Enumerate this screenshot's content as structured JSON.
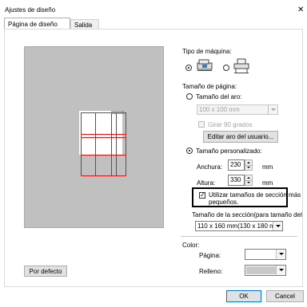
{
  "window": {
    "title": "Ajustes de diseño"
  },
  "tabs": [
    {
      "label": "Página de diseño",
      "active": true
    },
    {
      "label": "Salida",
      "active": false
    }
  ],
  "machine": {
    "label": "Tipo de máquina:"
  },
  "page_size": {
    "label": "Tamaño de página:",
    "hoop_option": "Tamaño del aro:",
    "hoop_value": "100 x 100 mm",
    "rotate_label": "Girar 90 grados",
    "edit_hoop_button": "Editar aro del usuario...",
    "custom_option": "Tamaño personalizado:",
    "width_label": "Anchura:",
    "width_value": "230",
    "height_label": "Altura:",
    "height_value": "330",
    "unit": "mm",
    "small_sections_label_1": "Utilizar tamaños de sección más",
    "small_sections_label_2": "pequeños.",
    "small_sections_checked": "✓",
    "section_size_label": "Tamaño de la sección(para tamaño del",
    "section_size_value": "110 x 160 mm(130 x 180 m"
  },
  "color": {
    "label": "Color:",
    "page_label": "Página:",
    "fill_label": "Relleno:",
    "page_color": "#ffffff",
    "fill_color": "#c8c8c8"
  },
  "buttons": {
    "default": "Por defecto",
    "ok": "OK",
    "cancel": "Cancel",
    "close": "✕"
  }
}
